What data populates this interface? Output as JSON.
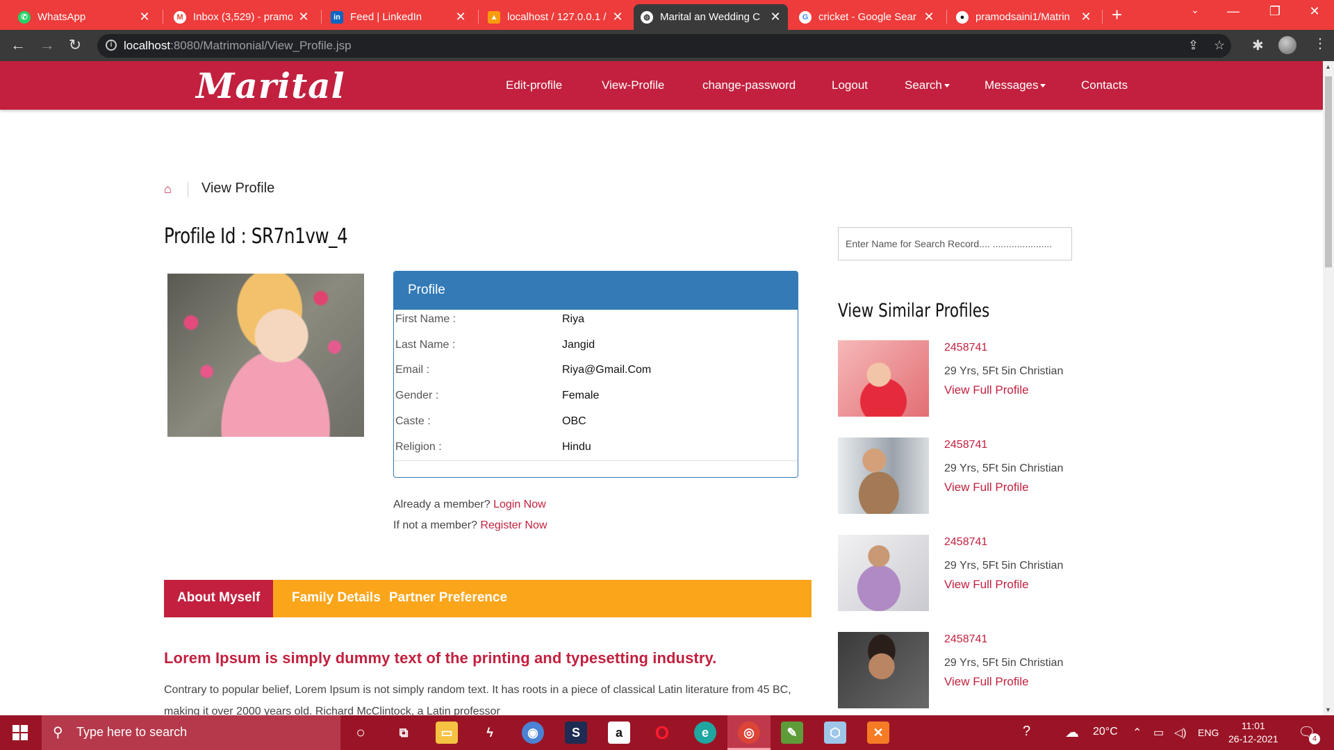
{
  "browser": {
    "tabs": [
      {
        "title": "WhatsApp",
        "icon": "whatsapp-icon",
        "color": "#25d366"
      },
      {
        "title": "Inbox (3,529) - pramo",
        "icon": "gmail-icon",
        "color": "#ea4335"
      },
      {
        "title": "Feed | LinkedIn",
        "icon": "linkedin-icon",
        "color": "#0a66c2"
      },
      {
        "title": "localhost / 127.0.0.1 /",
        "icon": "phpmyadmin-icon",
        "color": "#f89c0e"
      },
      {
        "title": "Marital an Wedding C",
        "icon": "globe-icon",
        "color": "#ffffff"
      },
      {
        "title": "cricket - Google Sear",
        "icon": "google-icon",
        "color": "#4285f4"
      },
      {
        "title": "pramodsaini1/Matrin",
        "icon": "github-icon",
        "color": "#ffffff"
      }
    ],
    "url_host": "localhost",
    "url_path": ":8080/Matrimonial/View_Profile.jsp"
  },
  "site": {
    "logo": "Marital",
    "nav": [
      "Edit-profile",
      "View-Profile",
      "change-password",
      "Logout",
      "Search",
      "Messages",
      "Contacts"
    ],
    "accent": "#c2203e",
    "tab_color": "#fba51a",
    "panel_color": "#337ab7"
  },
  "breadcrumb": {
    "current": "View Profile"
  },
  "profile": {
    "id_label": "Profile Id : SR7n1vw_4",
    "card_title": "Profile",
    "fields": [
      {
        "label": "First Name :",
        "value": "Riya"
      },
      {
        "label": "Last Name :",
        "value": "Jangid"
      },
      {
        "label": "Email :",
        "value": "Riya@Gmail.Com"
      },
      {
        "label": "Gender :",
        "value": "Female"
      },
      {
        "label": "Caste :",
        "value": "OBC"
      },
      {
        "label": "Religion :",
        "value": "Hindu"
      }
    ]
  },
  "member": {
    "already": "Already a member?",
    "login": "Login Now",
    "not": "If not a member?",
    "register": "Register Now"
  },
  "tabs": [
    "About Myself",
    "Family Details",
    "Partner Preference"
  ],
  "about": {
    "heading": "Lorem Ipsum is simply dummy text of the printing and typesetting industry.",
    "body": "Contrary to popular belief, Lorem Ipsum is not simply random text. It has roots in a piece of classical Latin literature from 45 BC, making it over 2000 years old. Richard McClintock, a Latin professor"
  },
  "sidebar": {
    "search_placeholder": "Enter Name for Search Record.... ......................",
    "similar_title": "View Similar Profiles",
    "profiles": [
      {
        "id": "2458741",
        "details": "29 Yrs, 5Ft 5in Christian",
        "link": "View Full Profile"
      },
      {
        "id": "2458741",
        "details": "29 Yrs, 5Ft 5in Christian",
        "link": "View Full Profile"
      },
      {
        "id": "2458741",
        "details": "29 Yrs, 5Ft 5in Christian",
        "link": "View Full Profile"
      },
      {
        "id": "2458741",
        "details": "29 Yrs, 5Ft 5in Christian",
        "link": "View Full Profile"
      }
    ]
  },
  "taskbar": {
    "search_placeholder": "Type here to search",
    "temperature": "20°C",
    "language": "ENG",
    "time": "11:01",
    "date": "26-12-2021",
    "notification_count": "4"
  }
}
